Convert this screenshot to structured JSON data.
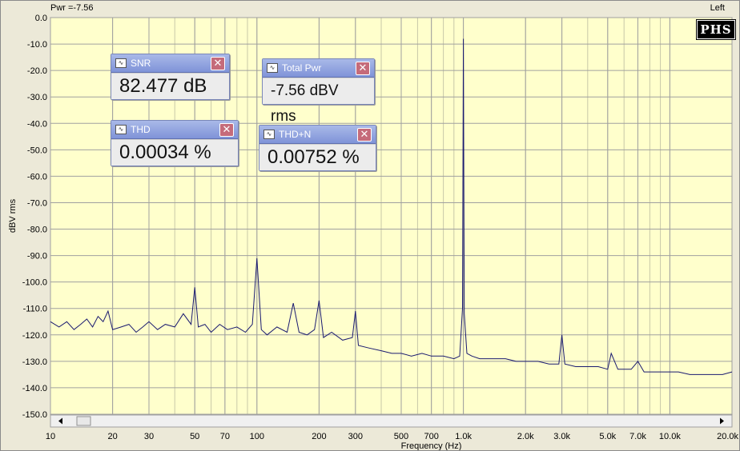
{
  "header": {
    "power_readout": "Pwr =-7.56",
    "channel": "Left"
  },
  "logo": {
    "text": "PHS"
  },
  "meters": {
    "snr": {
      "title": "SNR",
      "value": "82.477 dB"
    },
    "total_pwr": {
      "title": "Total Pwr",
      "value": "-7.56 dBV rms"
    },
    "thd": {
      "title": "THD",
      "value": "0.00034 %"
    },
    "thd_n": {
      "title": "THD+N",
      "value": "0.00752 %"
    }
  },
  "colors": {
    "plot_bg": "#ffffcc",
    "trace": "#1a1a70",
    "grid": "#a0a0a0",
    "meter_title": "#8395d9",
    "close": "#c56b7a"
  },
  "chart_data": {
    "type": "line",
    "title": "",
    "xlabel": "Frequency (Hz)",
    "ylabel": "dBV rms",
    "x_scale": "log",
    "xlim": [
      10,
      20000
    ],
    "ylim": [
      -150,
      0
    ],
    "x_tick_values": [
      10,
      20,
      30,
      50,
      70,
      100,
      200,
      300,
      500,
      700,
      1000,
      2000,
      3000,
      5000,
      7000,
      10000,
      20000
    ],
    "x_tick_labels": [
      "10",
      "20",
      "30",
      "50",
      "70",
      "100",
      "200",
      "300",
      "500",
      "700",
      "1.0k",
      "2.0k",
      "3.0k",
      "5.0k",
      "7.0k",
      "10.0k",
      "20.0k"
    ],
    "y_tick_values": [
      0,
      -10,
      -20,
      -30,
      -40,
      -50,
      -60,
      -70,
      -80,
      -90,
      -100,
      -110,
      -120,
      -130,
      -140,
      -150
    ],
    "y_tick_labels": [
      "0.0",
      "-10.0",
      "-20.0",
      "-30.0",
      "-40.0",
      "-50.0",
      "-60.0",
      "-70.0",
      "-80.0",
      "-90.0",
      "-100.0",
      "-110.0",
      "-120.0",
      "-130.0",
      "-140.0",
      "-150.0"
    ],
    "grid": true,
    "series": [
      {
        "x": [
          10,
          11,
          12,
          13,
          14,
          15,
          16,
          17,
          18,
          19,
          20,
          22,
          24,
          26,
          28,
          30,
          33,
          36,
          40,
          44,
          48,
          50,
          52,
          56,
          60,
          66,
          72,
          80,
          88,
          95,
          100,
          105,
          112,
          125,
          140,
          150,
          160,
          175,
          190,
          200,
          210,
          230,
          260,
          290,
          300,
          310,
          350,
          400,
          450,
          500,
          560,
          630,
          700,
          800,
          900,
          960,
          990,
          1000,
          1010,
          1040,
          1100,
          1200,
          1400,
          1600,
          1800,
          2000,
          2300,
          2600,
          2900,
          3000,
          3100,
          3500,
          4000,
          4500,
          5000,
          5200,
          5600,
          6000,
          6500,
          7000,
          7500,
          8000,
          9000,
          10000,
          11000,
          12500,
          14000,
          16000,
          18000,
          20000
        ],
        "y": [
          -115,
          -117,
          -115,
          -118,
          -116,
          -114,
          -117,
          -113,
          -115,
          -111,
          -118,
          -117,
          -116,
          -119,
          -117,
          -115,
          -118,
          -116,
          -117,
          -112,
          -116,
          -102,
          -117,
          -116,
          -119,
          -116,
          -118,
          -117,
          -119,
          -116,
          -91,
          -118,
          -120,
          -117,
          -119,
          -108,
          -119,
          -120,
          -118,
          -107,
          -121,
          -119,
          -122,
          -121,
          -111,
          -124,
          -125,
          -126,
          -127,
          -127,
          -128,
          -127,
          -128,
          -128,
          -129,
          -128,
          -110,
          -8,
          -112,
          -127,
          -128,
          -129,
          -129,
          -129,
          -130,
          -130,
          -130,
          -131,
          -131,
          -120,
          -131,
          -132,
          -132,
          -132,
          -133,
          -127,
          -133,
          -133,
          -133,
          -130,
          -134,
          -134,
          -134,
          -134,
          -134,
          -135,
          -135,
          -135,
          -135,
          -134
        ]
      }
    ]
  }
}
